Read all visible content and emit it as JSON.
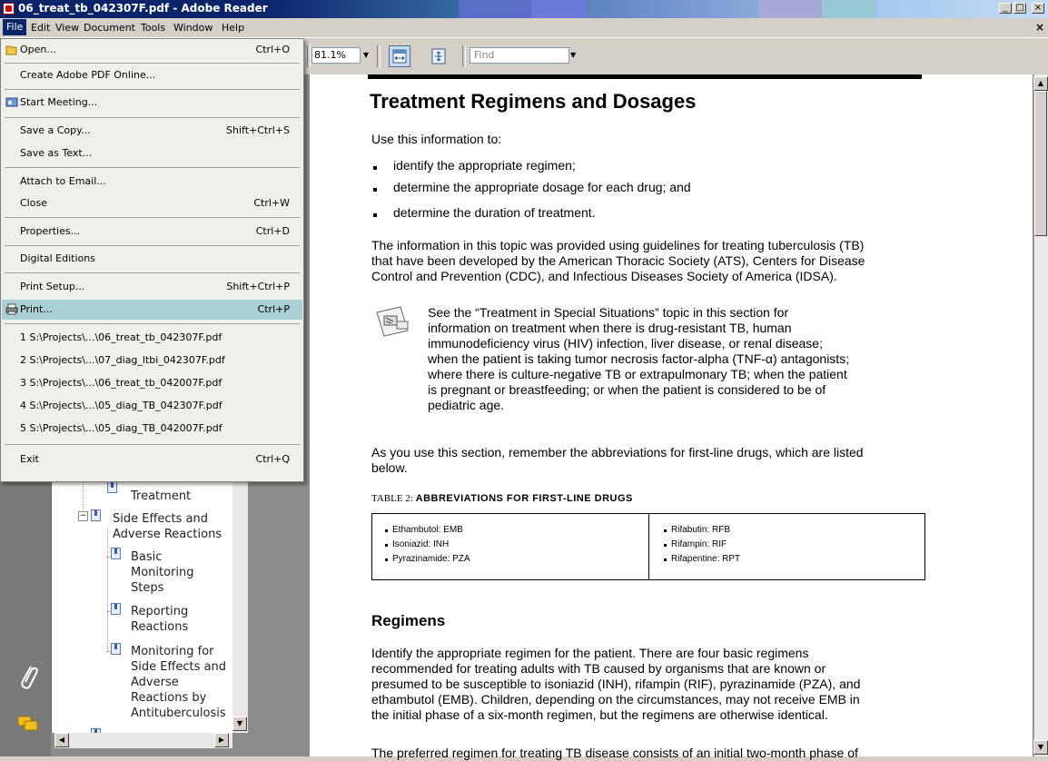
{
  "window": {
    "title": "06_treat_tb_042307F.pdf - Adobe Reader",
    "controls": [
      "_",
      "□",
      "×"
    ]
  },
  "menubar": {
    "items": [
      "File",
      "Edit",
      "View",
      "Document",
      "Tools",
      "Window",
      "Help"
    ],
    "close_doc": "×"
  },
  "toolbar": {
    "zoom": "81.1%",
    "find_placeholder": "Find"
  },
  "file_menu": {
    "items": [
      {
        "label": "Open...",
        "shortcut": "Ctrl+O",
        "icon": "folder-icon"
      },
      {
        "label": "Create Adobe PDF Online...",
        "shortcut": ""
      },
      {
        "label": "Start Meeting...",
        "shortcut": "",
        "icon": "meeting-icon"
      },
      {
        "label": "Save a Copy...",
        "shortcut": "Shift+Ctrl+S"
      },
      {
        "label": "Save as Text...",
        "shortcut": ""
      },
      {
        "label": "Attach to Email...",
        "shortcut": ""
      },
      {
        "label": "Close",
        "shortcut": "Ctrl+W"
      },
      {
        "label": "Properties...",
        "shortcut": "Ctrl+D"
      },
      {
        "label": "Digital Editions",
        "shortcut": ""
      },
      {
        "label": "Print Setup...",
        "shortcut": "Shift+Ctrl+P"
      },
      {
        "label": "Print...",
        "shortcut": "Ctrl+P",
        "icon": "printer-icon",
        "highlighted": true
      },
      {
        "label": "1 S:\\Projects\\...\\06_treat_tb_042307F.pdf",
        "shortcut": ""
      },
      {
        "label": "2 S:\\Projects\\...\\07_diag_ltbi_042307F.pdf",
        "shortcut": ""
      },
      {
        "label": "3 S:\\Projects\\...\\06_treat_tb_042007F.pdf",
        "shortcut": ""
      },
      {
        "label": "4 S:\\Projects\\...\\05_diag_TB_042307F.pdf",
        "shortcut": ""
      },
      {
        "label": "5 S:\\Projects\\...\\05_diag_TB_042007F.pdf",
        "shortcut": ""
      },
      {
        "label": "Exit",
        "shortcut": "Ctrl+Q"
      }
    ]
  },
  "bookmarks": {
    "items": [
      {
        "label": "Treatment"
      },
      {
        "label": "Side Effects and Adverse Reactions",
        "lines": [
          "Side Effects and",
          "Adverse Reactions"
        ],
        "expander": "−"
      },
      {
        "label": "Basic Monitoring Steps",
        "lines": [
          "Basic",
          "Monitoring",
          "Steps"
        ]
      },
      {
        "label": "Reporting Reactions",
        "lines": [
          "Reporting",
          "Reactions"
        ]
      },
      {
        "label": "Monitoring for Side Effects and Adverse Reactions by Antituberculosis",
        "lines": [
          "Monitoring for",
          "Side Effects and",
          "Adverse",
          "Reactions by",
          "Antituberculosis"
        ]
      }
    ]
  },
  "document": {
    "title": "Treatment Regimens and Dosages",
    "intro": "Use this information to:",
    "bullets": [
      "identify the appropriate regimen;",
      "determine the appropriate dosage for each drug; and",
      "determine the duration of treatment."
    ],
    "para1_lines": [
      "The information in this topic was provided using guidelines for treating tuberculosis (TB)",
      "that have been developed by the American Thoracic Society (ATS), Centers for Disease",
      "Control and Prevention (CDC), and Infectious Diseases Society of America (IDSA)."
    ],
    "note_lines": [
      "See the “Treatment in Special Situations” topic in this section for",
      "information on treatment when there is drug-resistant TB, human",
      "immunodeficiency virus (HIV) infection, liver disease, or renal disease;",
      "when the patient is taking tumor necrosis factor-alpha (TNF-α) antagonists;",
      "where there is culture-negative TB or extrapulmonary TB; when the patient",
      "is pregnant or breastfeeding; or when the patient is considered to be of",
      "pediatric age."
    ],
    "para2_lines": [
      "As you use this section, remember the abbreviations for first-line drugs, which are listed",
      "below."
    ],
    "table_caption_prefix": "TABLE 2:",
    "table_caption": "ABBREVIATIONS FOR FIRST-LINE DRUGS",
    "table_left": [
      "Ethambutol: EMB",
      "Isoniazid: INH",
      "Pyrazinamide: PZA"
    ],
    "table_right": [
      "Rifabutin: RFB",
      "Rifampin: RIF",
      "Rifapentine: RPT"
    ],
    "regimens_heading": "Regimens",
    "para3_lines": [
      "Identify the appropriate regimen for the patient. There are four basic regimens",
      "recommended for treating adults with TB caused by organisms that are known or",
      "presumed to be susceptible to isoniazid (INH), rifampin (RIF), pyrazinamide (PZA), and",
      "ethambutol (EMB). Children, depending on the circumstances, may not receive EMB in",
      "the initial phase of a six-month regimen, but the regimens are otherwise identical."
    ],
    "para4_partial": "The preferred regimen for treating TB disease consists of an initial two-month phase of"
  },
  "colors": {
    "menu_highlight": "#a9d0d4",
    "title_bar": "#0a246a",
    "nav_panel": "#8c8c8c"
  }
}
